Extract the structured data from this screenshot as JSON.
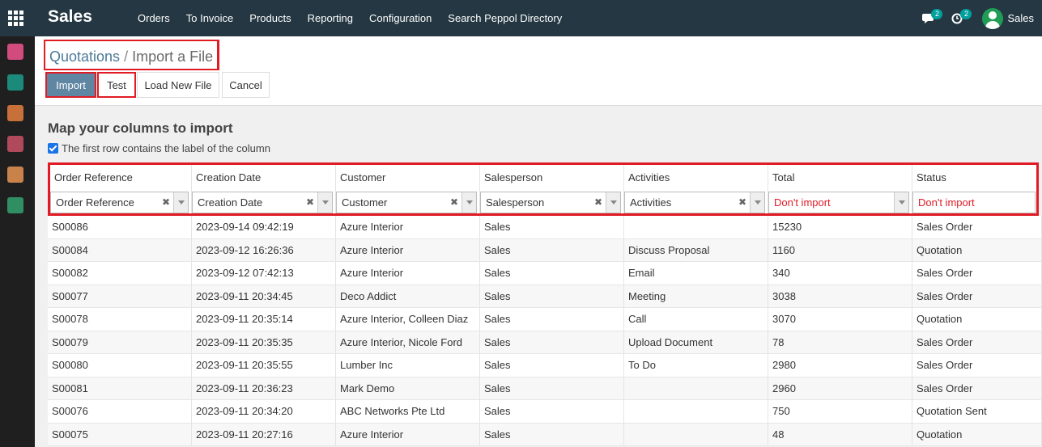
{
  "nav": {
    "brand": "Sales",
    "menu": [
      "Orders",
      "To Invoice",
      "Products",
      "Reporting",
      "Configuration",
      "Search Peppol Directory"
    ],
    "messages_badge": "2",
    "activities_badge": "2",
    "user_name": "Sales"
  },
  "breadcrumb": {
    "parent": "Quotations",
    "separator": "/",
    "current": "Import a File"
  },
  "buttons": {
    "import": "Import",
    "test": "Test",
    "load_new": "Load New File",
    "cancel": "Cancel"
  },
  "main": {
    "title": "Map your columns to import",
    "first_row_label": "The first row contains the label of the column",
    "first_row_checked": true
  },
  "columns": [
    "Order Reference",
    "Creation Date",
    "Customer",
    "Salesperson",
    "Activities",
    "Total",
    "Status"
  ],
  "mappings": [
    {
      "label": "Order Reference",
      "import": true
    },
    {
      "label": "Creation Date",
      "import": true
    },
    {
      "label": "Customer",
      "import": true
    },
    {
      "label": "Salesperson",
      "import": true
    },
    {
      "label": "Activities",
      "import": true
    },
    {
      "label": "Don't import",
      "import": false
    },
    {
      "label": "Don't import",
      "import": false
    }
  ],
  "rows": [
    [
      "S00086",
      "2023-09-14 09:42:19",
      "Azure Interior",
      "Sales",
      "",
      "15230",
      "Sales Order"
    ],
    [
      "S00084",
      "2023-09-12 16:26:36",
      "Azure Interior",
      "Sales",
      "Discuss Proposal",
      "1160",
      "Quotation"
    ],
    [
      "S00082",
      "2023-09-12 07:42:13",
      "Azure Interior",
      "Sales",
      "Email",
      "340",
      "Sales Order"
    ],
    [
      "S00077",
      "2023-09-11 20:34:45",
      "Deco Addict",
      "Sales",
      "Meeting",
      "3038",
      "Sales Order"
    ],
    [
      "S00078",
      "2023-09-11 20:35:14",
      "Azure Interior, Colleen Diaz",
      "Sales",
      "Call",
      "3070",
      "Quotation"
    ],
    [
      "S00079",
      "2023-09-11 20:35:35",
      "Azure Interior, Nicole Ford",
      "Sales",
      "Upload Document",
      "78",
      "Sales Order"
    ],
    [
      "S00080",
      "2023-09-11 20:35:55",
      "Lumber Inc",
      "Sales",
      "To Do",
      "2980",
      "Sales Order"
    ],
    [
      "S00081",
      "2023-09-11 20:36:23",
      "Mark Demo",
      "Sales",
      "",
      "2960",
      "Sales Order"
    ],
    [
      "S00076",
      "2023-09-11 20:34:20",
      "ABC Networks Pte Ltd",
      "Sales",
      "",
      "750",
      "Quotation Sent"
    ],
    [
      "S00075",
      "2023-09-11 20:27:16",
      "Azure Interior",
      "Sales",
      "",
      "48",
      "Quotation"
    ]
  ],
  "colors": {
    "nav_bg": "#243742",
    "primary": "#5f86a3",
    "highlight": "#e01b24",
    "link": "#4c7a99"
  }
}
